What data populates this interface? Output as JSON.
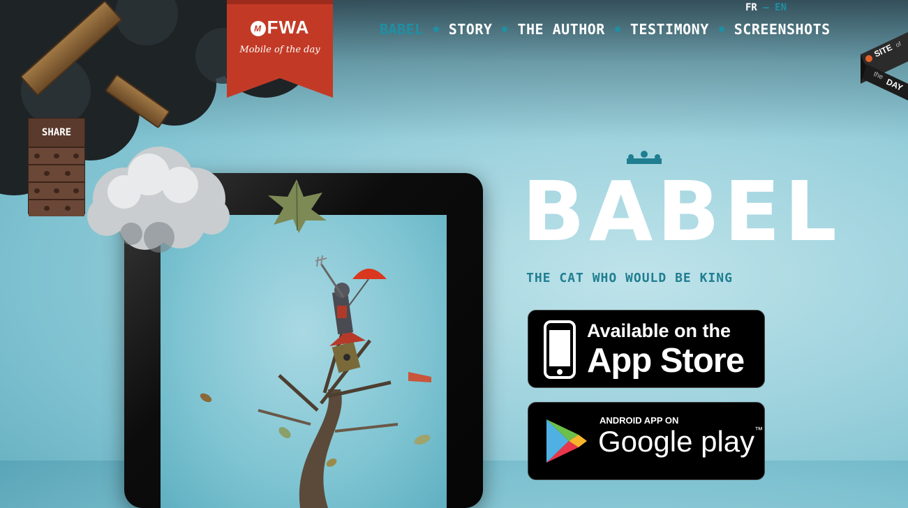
{
  "badge": {
    "brand": "FWA",
    "brand_mark": "M",
    "subtitle": "Mobile of the day"
  },
  "language": {
    "fr": "FR",
    "separator": "–",
    "en": "EN"
  },
  "nav": {
    "items": [
      {
        "label": "BABEL",
        "active": true
      },
      {
        "label": "STORY",
        "active": false
      },
      {
        "label": "THE AUTHOR",
        "active": false
      },
      {
        "label": "TESTIMONY",
        "active": false
      },
      {
        "label": "SCREENSHOTS",
        "active": false
      }
    ]
  },
  "site_of_the_day": {
    "site": "SITE",
    "of": "of",
    "the": "the",
    "day": "DAY"
  },
  "share": {
    "label": "SHARE"
  },
  "hero": {
    "title": "BABEL",
    "tagline": "THE CAT WHO WOULD BE KING"
  },
  "stores": {
    "apple": {
      "line1": "Available on the",
      "line2": "App Store"
    },
    "google": {
      "line1": "ANDROID APP ON",
      "line2": "Google play",
      "trademark": "™"
    }
  },
  "colors": {
    "accent": "#1f8fa3",
    "ribbon": "#c23a26",
    "sky": "#9fd3de"
  }
}
